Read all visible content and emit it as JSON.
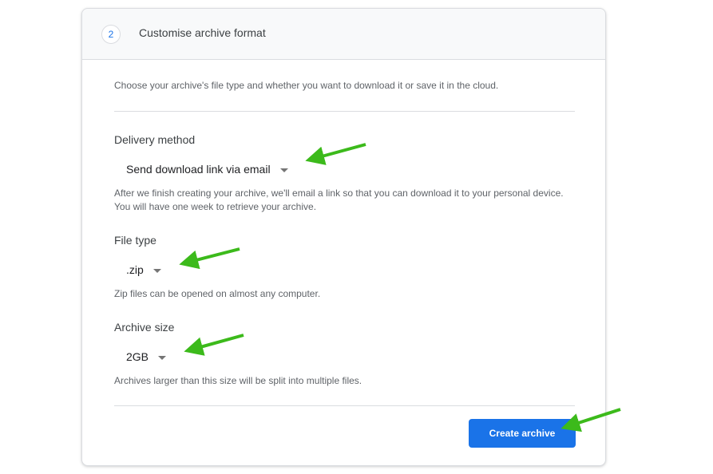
{
  "step": {
    "number": "2",
    "title": "Customise archive format"
  },
  "intro_text": "Choose your archive's file type and whether you want to download it or save it in the cloud.",
  "delivery": {
    "label": "Delivery method",
    "value": "Send download link via email",
    "help": "After we finish creating your archive, we'll email a link so that you can download it to your personal device. You will have one week to retrieve your archive."
  },
  "file_type": {
    "label": "File type",
    "value": ".zip",
    "help": "Zip files can be opened on almost any computer."
  },
  "archive_size": {
    "label": "Archive size",
    "value": "2GB",
    "help": "Archives larger than this size will be split into multiple files."
  },
  "create_button": "Create archive",
  "colors": {
    "accent": "#1a73e8",
    "annotation_arrow": "#3cba1b",
    "header_bg": "#f8f9fa"
  }
}
